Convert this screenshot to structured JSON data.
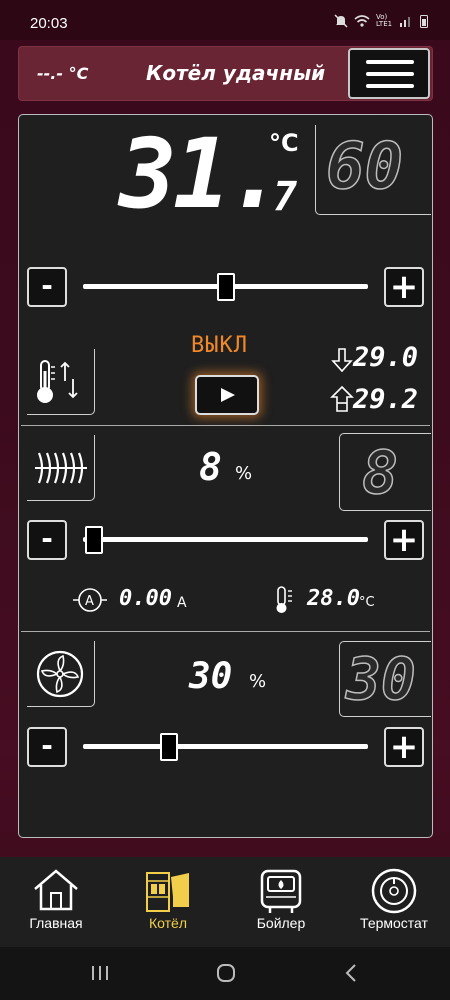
{
  "status": {
    "time": "20:03",
    "network": "Vo) LTE1"
  },
  "header": {
    "temperature": "--.- °C",
    "title": "Котёл удачный",
    "menu_icon": "hamburger-menu-icon"
  },
  "boiler": {
    "current_temp_main": "31.",
    "current_temp_decimal": "7",
    "temp_unit": "°C",
    "setpoint": "60",
    "setpoint_fraction": 0.5,
    "state_label": "ВЫКЛ",
    "hysteresis_low": "29.0",
    "hysteresis_high": "29.2"
  },
  "auger": {
    "percent": "8",
    "unit": "%",
    "display": "8",
    "slider_fraction": 0.04,
    "current": "0.00",
    "current_unit": "A",
    "temperature": "28.0",
    "temperature_unit": "°C"
  },
  "fan": {
    "percent": "30",
    "unit": "%",
    "display": "30",
    "slider_fraction": 0.3
  },
  "controls": {
    "minus_label": "-",
    "plus_label": "+"
  },
  "nav": {
    "items": [
      {
        "label": "Главная",
        "icon": "home-icon"
      },
      {
        "label": "Котёл",
        "icon": "boiler-icon",
        "active": true
      },
      {
        "label": "Бойлер",
        "icon": "water-heater-icon"
      },
      {
        "label": "Термостат",
        "icon": "thermostat-icon"
      }
    ]
  },
  "colors": {
    "accent": "#f0882a",
    "active_nav": "#f2cf4a",
    "panel": "#1f1f1f",
    "header": "#6a2535"
  }
}
